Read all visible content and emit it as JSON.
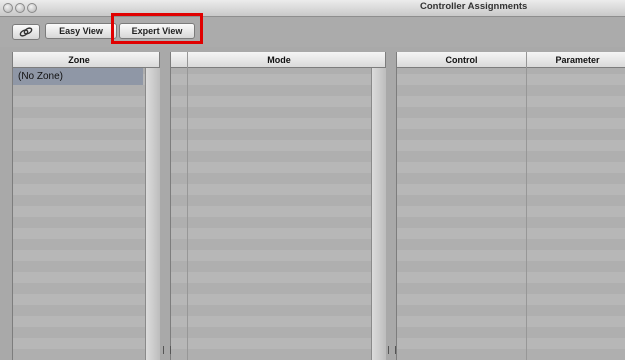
{
  "window": {
    "title": "Controller Assignments"
  },
  "toolbar": {
    "link_icon": "link-icon",
    "easy_view_label": "Easy View",
    "expert_view_label": "Expert View"
  },
  "zone_panel": {
    "header": "Zone",
    "items": [
      "(No Zone)"
    ]
  },
  "mode_panel": {
    "header": "Mode"
  },
  "control_panel": {
    "headers": [
      "Control",
      "Parameter"
    ]
  }
}
